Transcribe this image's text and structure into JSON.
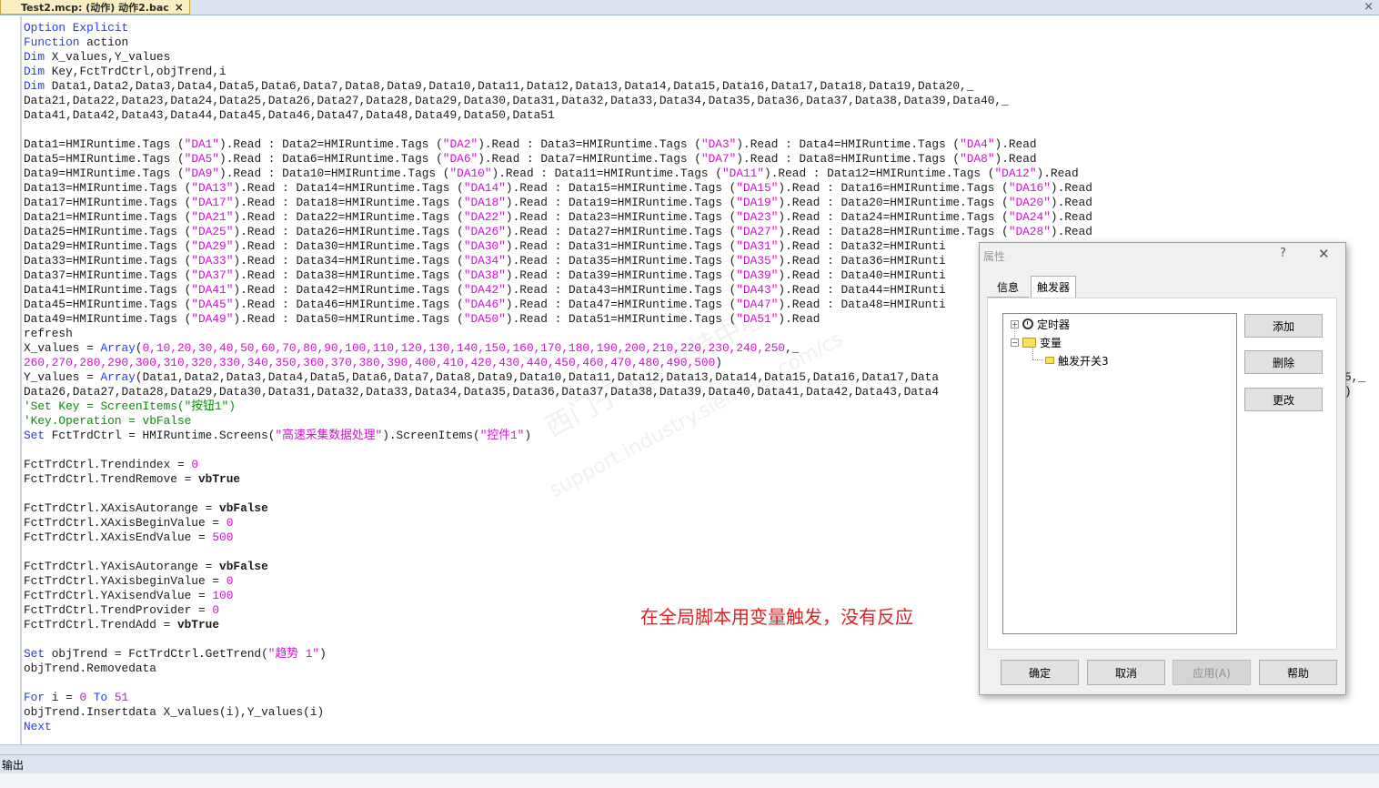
{
  "tab": {
    "title": "Test2.mcp: (动作) 动作2.bac",
    "close": "×"
  },
  "window_close": "×",
  "code_lines": [
    [
      [
        "kw",
        "Option Explicit"
      ]
    ],
    [
      [
        "kw",
        "Function"
      ],
      [
        "t",
        " action"
      ]
    ],
    [
      [
        "kw",
        "Dim"
      ],
      [
        "t",
        " X_values,Y_values"
      ]
    ],
    [
      [
        "kw",
        "Dim"
      ],
      [
        "t",
        " Key,FctTrdCtrl,objTrend,i"
      ]
    ],
    [
      [
        "kw",
        "Dim"
      ],
      [
        "t",
        " Data1,Data2,Data3,Data4,Data5,Data6,Data7,Data8,Data9,Data10,Data11,Data12,Data13,Data14,Data15,Data16,Data17,Data18,Data19,Data20,_"
      ]
    ],
    [
      [
        "t",
        "Data21,Data22,Data23,Data24,Data25,Data26,Data27,Data28,Data29,Data30,Data31,Data32,Data33,Data34,Data35,Data36,Data37,Data38,Data39,Data40,_"
      ]
    ],
    [
      [
        "t",
        "Data41,Data42,Data43,Data44,Data45,Data46,Data47,Data48,Data49,Data50,Data51"
      ]
    ],
    [],
    [
      [
        "t",
        "Data1=HMIRuntime.Tags ("
      ],
      [
        "s",
        "\"DA1\""
      ],
      [
        "t",
        ").Read : Data2=HMIRuntime.Tags ("
      ],
      [
        "s",
        "\"DA2\""
      ],
      [
        "t",
        ").Read : Data3=HMIRuntime.Tags ("
      ],
      [
        "s",
        "\"DA3\""
      ],
      [
        "t",
        ").Read : Data4=HMIRuntime.Tags ("
      ],
      [
        "s",
        "\"DA4\""
      ],
      [
        "t",
        ").Read"
      ]
    ],
    [
      [
        "t",
        "Data5=HMIRuntime.Tags ("
      ],
      [
        "s",
        "\"DA5\""
      ],
      [
        "t",
        ").Read : Data6=HMIRuntime.Tags ("
      ],
      [
        "s",
        "\"DA6\""
      ],
      [
        "t",
        ").Read : Data7=HMIRuntime.Tags ("
      ],
      [
        "s",
        "\"DA7\""
      ],
      [
        "t",
        ").Read : Data8=HMIRuntime.Tags ("
      ],
      [
        "s",
        "\"DA8\""
      ],
      [
        "t",
        ").Read"
      ]
    ],
    [
      [
        "t",
        "Data9=HMIRuntime.Tags ("
      ],
      [
        "s",
        "\"DA9\""
      ],
      [
        "t",
        ").Read : Data10=HMIRuntime.Tags ("
      ],
      [
        "s",
        "\"DA10\""
      ],
      [
        "t",
        ").Read : Data11=HMIRuntime.Tags ("
      ],
      [
        "s",
        "\"DA11\""
      ],
      [
        "t",
        ").Read : Data12=HMIRuntime.Tags ("
      ],
      [
        "s",
        "\"DA12\""
      ],
      [
        "t",
        ").Read"
      ]
    ],
    [
      [
        "t",
        "Data13=HMIRuntime.Tags ("
      ],
      [
        "s",
        "\"DA13\""
      ],
      [
        "t",
        ").Read : Data14=HMIRuntime.Tags ("
      ],
      [
        "s",
        "\"DA14\""
      ],
      [
        "t",
        ").Read : Data15=HMIRuntime.Tags ("
      ],
      [
        "s",
        "\"DA15\""
      ],
      [
        "t",
        ").Read : Data16=HMIRuntime.Tags ("
      ],
      [
        "s",
        "\"DA16\""
      ],
      [
        "t",
        ").Read"
      ]
    ],
    [
      [
        "t",
        "Data17=HMIRuntime.Tags ("
      ],
      [
        "s",
        "\"DA17\""
      ],
      [
        "t",
        ").Read : Data18=HMIRuntime.Tags ("
      ],
      [
        "s",
        "\"DA18\""
      ],
      [
        "t",
        ").Read : Data19=HMIRuntime.Tags ("
      ],
      [
        "s",
        "\"DA19\""
      ],
      [
        "t",
        ").Read : Data20=HMIRuntime.Tags ("
      ],
      [
        "s",
        "\"DA20\""
      ],
      [
        "t",
        ").Read"
      ]
    ],
    [
      [
        "t",
        "Data21=HMIRuntime.Tags ("
      ],
      [
        "s",
        "\"DA21\""
      ],
      [
        "t",
        ").Read : Data22=HMIRuntime.Tags ("
      ],
      [
        "s",
        "\"DA22\""
      ],
      [
        "t",
        ").Read : Data23=HMIRuntime.Tags ("
      ],
      [
        "s",
        "\"DA23\""
      ],
      [
        "t",
        ").Read : Data24=HMIRuntime.Tags ("
      ],
      [
        "s",
        "\"DA24\""
      ],
      [
        "t",
        ").Read"
      ]
    ],
    [
      [
        "t",
        "Data25=HMIRuntime.Tags ("
      ],
      [
        "s",
        "\"DA25\""
      ],
      [
        "t",
        ").Read : Data26=HMIRuntime.Tags ("
      ],
      [
        "s",
        "\"DA26\""
      ],
      [
        "t",
        ").Read : Data27=HMIRuntime.Tags ("
      ],
      [
        "s",
        "\"DA27\""
      ],
      [
        "t",
        ").Read : Data28=HMIRuntime.Tags ("
      ],
      [
        "s",
        "\"DA28\""
      ],
      [
        "t",
        ").Read"
      ]
    ],
    [
      [
        "t",
        "Data29=HMIRuntime.Tags ("
      ],
      [
        "s",
        "\"DA29\""
      ],
      [
        "t",
        ").Read : Data30=HMIRuntime.Tags ("
      ],
      [
        "s",
        "\"DA30\""
      ],
      [
        "t",
        ").Read : Data31=HMIRuntime.Tags ("
      ],
      [
        "s",
        "\"DA31\""
      ],
      [
        "t",
        ").Read : Data32=HMIRunti"
      ]
    ],
    [
      [
        "t",
        "Data33=HMIRuntime.Tags ("
      ],
      [
        "s",
        "\"DA33\""
      ],
      [
        "t",
        ").Read : Data34=HMIRuntime.Tags ("
      ],
      [
        "s",
        "\"DA34\""
      ],
      [
        "t",
        ").Read : Data35=HMIRuntime.Tags ("
      ],
      [
        "s",
        "\"DA35\""
      ],
      [
        "t",
        ").Read : Data36=HMIRunti"
      ]
    ],
    [
      [
        "t",
        "Data37=HMIRuntime.Tags ("
      ],
      [
        "s",
        "\"DA37\""
      ],
      [
        "t",
        ").Read : Data38=HMIRuntime.Tags ("
      ],
      [
        "s",
        "\"DA38\""
      ],
      [
        "t",
        ").Read : Data39=HMIRuntime.Tags ("
      ],
      [
        "s",
        "\"DA39\""
      ],
      [
        "t",
        ").Read : Data40=HMIRunti"
      ]
    ],
    [
      [
        "t",
        "Data41=HMIRuntime.Tags ("
      ],
      [
        "s",
        "\"DA41\""
      ],
      [
        "t",
        ").Read : Data42=HMIRuntime.Tags ("
      ],
      [
        "s",
        "\"DA42\""
      ],
      [
        "t",
        ").Read : Data43=HMIRuntime.Tags ("
      ],
      [
        "s",
        "\"DA43\""
      ],
      [
        "t",
        ").Read : Data44=HMIRunti"
      ]
    ],
    [
      [
        "t",
        "Data45=HMIRuntime.Tags ("
      ],
      [
        "s",
        "\"DA45\""
      ],
      [
        "t",
        ").Read : Data46=HMIRuntime.Tags ("
      ],
      [
        "s",
        "\"DA46\""
      ],
      [
        "t",
        ").Read : Data47=HMIRuntime.Tags ("
      ],
      [
        "s",
        "\"DA47\""
      ],
      [
        "t",
        ").Read : Data48=HMIRunti"
      ]
    ],
    [
      [
        "t",
        "Data49=HMIRuntime.Tags ("
      ],
      [
        "s",
        "\"DA49\""
      ],
      [
        "t",
        ").Read : Data50=HMIRuntime.Tags ("
      ],
      [
        "s",
        "\"DA50\""
      ],
      [
        "t",
        ").Read : Data51=HMIRuntime.Tags ("
      ],
      [
        "s",
        "\"DA51\""
      ],
      [
        "t",
        ").Read"
      ]
    ],
    [
      [
        "t",
        "refresh"
      ]
    ],
    [
      [
        "t",
        "X_values = "
      ],
      [
        "kw",
        "Array"
      ],
      [
        "t",
        "("
      ],
      [
        "n",
        "0,10,20,30,40,50,60,70,80,90,100,110,120,130,140,150,160,170,180,190,200,210,220,230,240,250"
      ],
      [
        "t",
        ",_"
      ]
    ],
    [
      [
        "n",
        "260,270,280,290,300,310,320,330,340,350,360,370,380,390,400,410,420,430,440,450,460,470,480,490,500"
      ],
      [
        "t",
        ")"
      ]
    ],
    [
      [
        "t",
        "Y_values = "
      ],
      [
        "kw",
        "Array"
      ],
      [
        "t",
        "(Data1,Data2,Data3,Data4,Data5,Data6,Data7,Data8,Data9,Data10,Data11,Data12,Data13,Data14,Data15,Data16,Data17,Data"
      ]
    ],
    [
      [
        "t",
        "Data26,Data27,Data28,Data29,Data30,Data31,Data32,Data33,Data34,Data35,Data36,Data37,Data38,Data39,Data40,Data41,Data42,Data43,Data4"
      ]
    ],
    [
      [
        "c",
        "'Set Key = ScreenItems(\"按钮1\")"
      ]
    ],
    [
      [
        "c",
        "'Key.Operation = vbFalse"
      ]
    ],
    [
      [
        "kw",
        "Set"
      ],
      [
        "t",
        " FctTrdCtrl = HMIRuntime.Screens("
      ],
      [
        "s",
        "\"高速采集数据处理\""
      ],
      [
        "t",
        ").ScreenItems("
      ],
      [
        "s",
        "\"控件1\""
      ],
      [
        "t",
        ")"
      ]
    ],
    [],
    [
      [
        "t",
        "FctTrdCtrl.Trendindex = "
      ],
      [
        "n",
        "0"
      ]
    ],
    [
      [
        "t",
        "FctTrdCtrl.TrendRemove = "
      ],
      [
        "b",
        "vbTrue"
      ]
    ],
    [],
    [
      [
        "t",
        "FctTrdCtrl.XAxisAutorange = "
      ],
      [
        "b",
        "vbFalse"
      ]
    ],
    [
      [
        "t",
        "FctTrdCtrl.XAxisBeginValue = "
      ],
      [
        "n",
        "0"
      ]
    ],
    [
      [
        "t",
        "FctTrdCtrl.XAxisEndValue = "
      ],
      [
        "n",
        "500"
      ]
    ],
    [],
    [
      [
        "t",
        "FctTrdCtrl.YAxisAutorange = "
      ],
      [
        "b",
        "vbFalse"
      ]
    ],
    [
      [
        "t",
        "FctTrdCtrl.YAxisbeginValue = "
      ],
      [
        "n",
        "0"
      ]
    ],
    [
      [
        "t",
        "FctTrdCtrl.YAxisendValue = "
      ],
      [
        "n",
        "100"
      ]
    ],
    [
      [
        "t",
        "FctTrdCtrl.TrendProvider = "
      ],
      [
        "n",
        "0"
      ]
    ],
    [
      [
        "t",
        "FctTrdCtrl.TrendAdd = "
      ],
      [
        "b",
        "vbTrue"
      ]
    ],
    [],
    [
      [
        "kw",
        "Set"
      ],
      [
        "t",
        " objTrend = FctTrdCtrl.GetTrend("
      ],
      [
        "s",
        "\"趋势 1\""
      ],
      [
        "t",
        ")"
      ]
    ],
    [
      [
        "t",
        "objTrend.Removedata"
      ]
    ],
    [],
    [
      [
        "kw",
        "For"
      ],
      [
        "t",
        " i = "
      ],
      [
        "n",
        "0"
      ],
      [
        "t",
        " "
      ],
      [
        "kw",
        "To"
      ],
      [
        "t",
        " "
      ],
      [
        "n",
        "51"
      ]
    ],
    [
      [
        "t",
        "objTrend.Insertdata X_values(i),Y_values(i)"
      ]
    ],
    [
      [
        "kw",
        "Next"
      ]
    ]
  ],
  "overflow_fragments": {
    "line24_tail": "5,_",
    "line25_tail": ")"
  },
  "annotation": "在全局脚本用变量触发，没有反应",
  "watermark": {
    "line1": "西门子工业支持中心",
    "line2": "support.industry.siemens.com/cs"
  },
  "output_label": "输出",
  "dialog": {
    "title": "属性",
    "help": "?",
    "close": "✕",
    "tabs": [
      {
        "label": "信息"
      },
      {
        "label": "触发器"
      }
    ],
    "tree": [
      {
        "label": "定时器"
      },
      {
        "label": "变量"
      },
      {
        "label": "触发开关3"
      }
    ],
    "side_buttons": [
      {
        "label": "添加"
      },
      {
        "label": "删除"
      },
      {
        "label": "更改"
      }
    ],
    "footer_buttons": [
      {
        "label": "确定"
      },
      {
        "label": "取消"
      },
      {
        "label": "应用(A)",
        "disabled": true
      },
      {
        "label": "帮助"
      }
    ]
  },
  "colors": {
    "keyword": "#1f3bff",
    "string": "#d10fd1",
    "comment": "#009000",
    "annotation": "#e02020"
  }
}
